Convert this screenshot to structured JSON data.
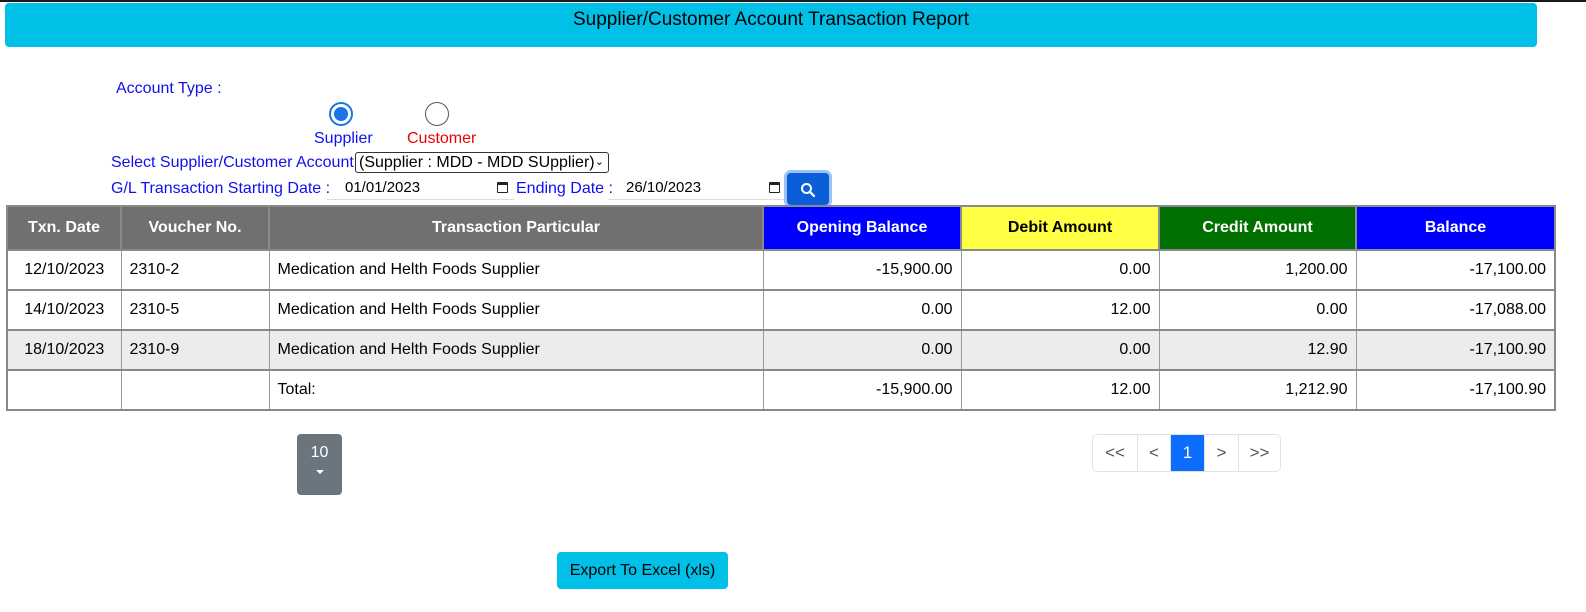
{
  "header": {
    "title": "Supplier/Customer Account Transaction Report"
  },
  "filters": {
    "account_type_label": "Account Type :",
    "radios": [
      {
        "label": "Supplier",
        "checked": true,
        "color": "#1010ee"
      },
      {
        "label": "Customer",
        "checked": false,
        "color": "#ee0000"
      }
    ],
    "account_label": "Select Supplier/Customer Account:",
    "account_value": "(Supplier : MDD - MDD SUpplier)",
    "start_label": "G/L Transaction Starting Date :",
    "start_value": "01/01/2023",
    "end_label": "Ending Date :",
    "end_value": "26/10/2023"
  },
  "table": {
    "headers": [
      "Txn. Date",
      "Voucher No.",
      "Transaction Particular",
      "Opening Balance",
      "Debit Amount",
      "Credit Amount",
      "Balance"
    ],
    "rows": [
      [
        "12/10/2023",
        "2310-2",
        "Medication and Helth Foods Supplier",
        "-15,900.00",
        "0.00",
        "1,200.00",
        "-17,100.00"
      ],
      [
        "14/10/2023",
        "2310-5",
        "Medication and Helth Foods Supplier",
        "0.00",
        "12.00",
        "0.00",
        "-17,088.00"
      ],
      [
        "18/10/2023",
        "2310-9",
        "Medication and Helth Foods Supplier",
        "0.00",
        "0.00",
        "12.90",
        "-17,100.90"
      ]
    ],
    "total": [
      "",
      "",
      "Total:",
      "-15,900.00",
      "12.00",
      "1,212.90",
      "-17,100.90"
    ]
  },
  "pagination": {
    "page_size": "10",
    "controls": [
      "<<",
      "<",
      "1",
      ">",
      ">>"
    ],
    "active": "1"
  },
  "export": {
    "label": "Export To Excel (xls)"
  },
  "colors": {
    "header_bg": "#00c0e8",
    "opening_balance_bg": "#0000ff",
    "debit_bg": "#ffff44",
    "credit_bg": "#007000",
    "balance_bg": "#0000ff"
  }
}
